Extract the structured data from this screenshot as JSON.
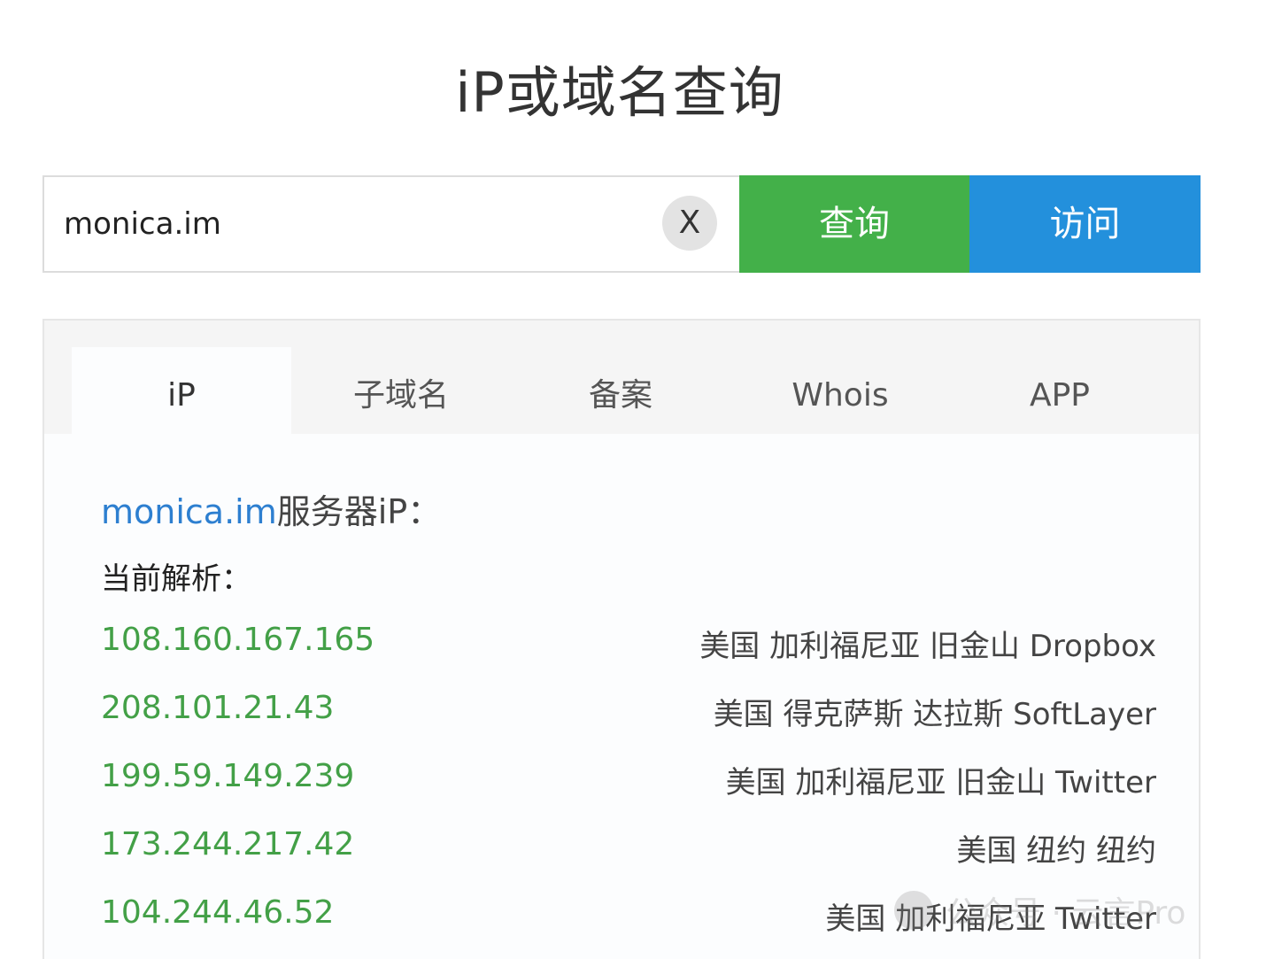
{
  "page": {
    "title": "iP或域名查询"
  },
  "search": {
    "value": "monica.im",
    "clear_label": "X",
    "query_button": "查询",
    "visit_button": "访问"
  },
  "tabs": [
    {
      "label": "iP",
      "active": true
    },
    {
      "label": "子域名",
      "active": false
    },
    {
      "label": "备案",
      "active": false
    },
    {
      "label": "Whois",
      "active": false
    },
    {
      "label": "APP",
      "active": false
    }
  ],
  "result": {
    "domain": "monica.im",
    "heading_suffix": "服务器iP：",
    "current_label": "当前解析：",
    "rows": [
      {
        "ip": "108.160.167.165",
        "location": "美国 加利福尼亚 旧金山 Dropbox"
      },
      {
        "ip": "208.101.21.43",
        "location": "美国 得克萨斯 达拉斯 SoftLayer"
      },
      {
        "ip": "199.59.149.239",
        "location": "美国 加利福尼亚 旧金山 Twitter"
      },
      {
        "ip": "173.244.217.42",
        "location": "美国 纽约 纽约"
      },
      {
        "ip": "104.244.46.52",
        "location": "美国 加利福尼亚 Twitter"
      }
    ]
  },
  "watermark": {
    "text": "公众号 · 云言Pro"
  },
  "colors": {
    "query_button": "#43b049",
    "visit_button": "#2390dc",
    "ip_text": "#43a047",
    "domain_text": "#2d7fd0"
  }
}
